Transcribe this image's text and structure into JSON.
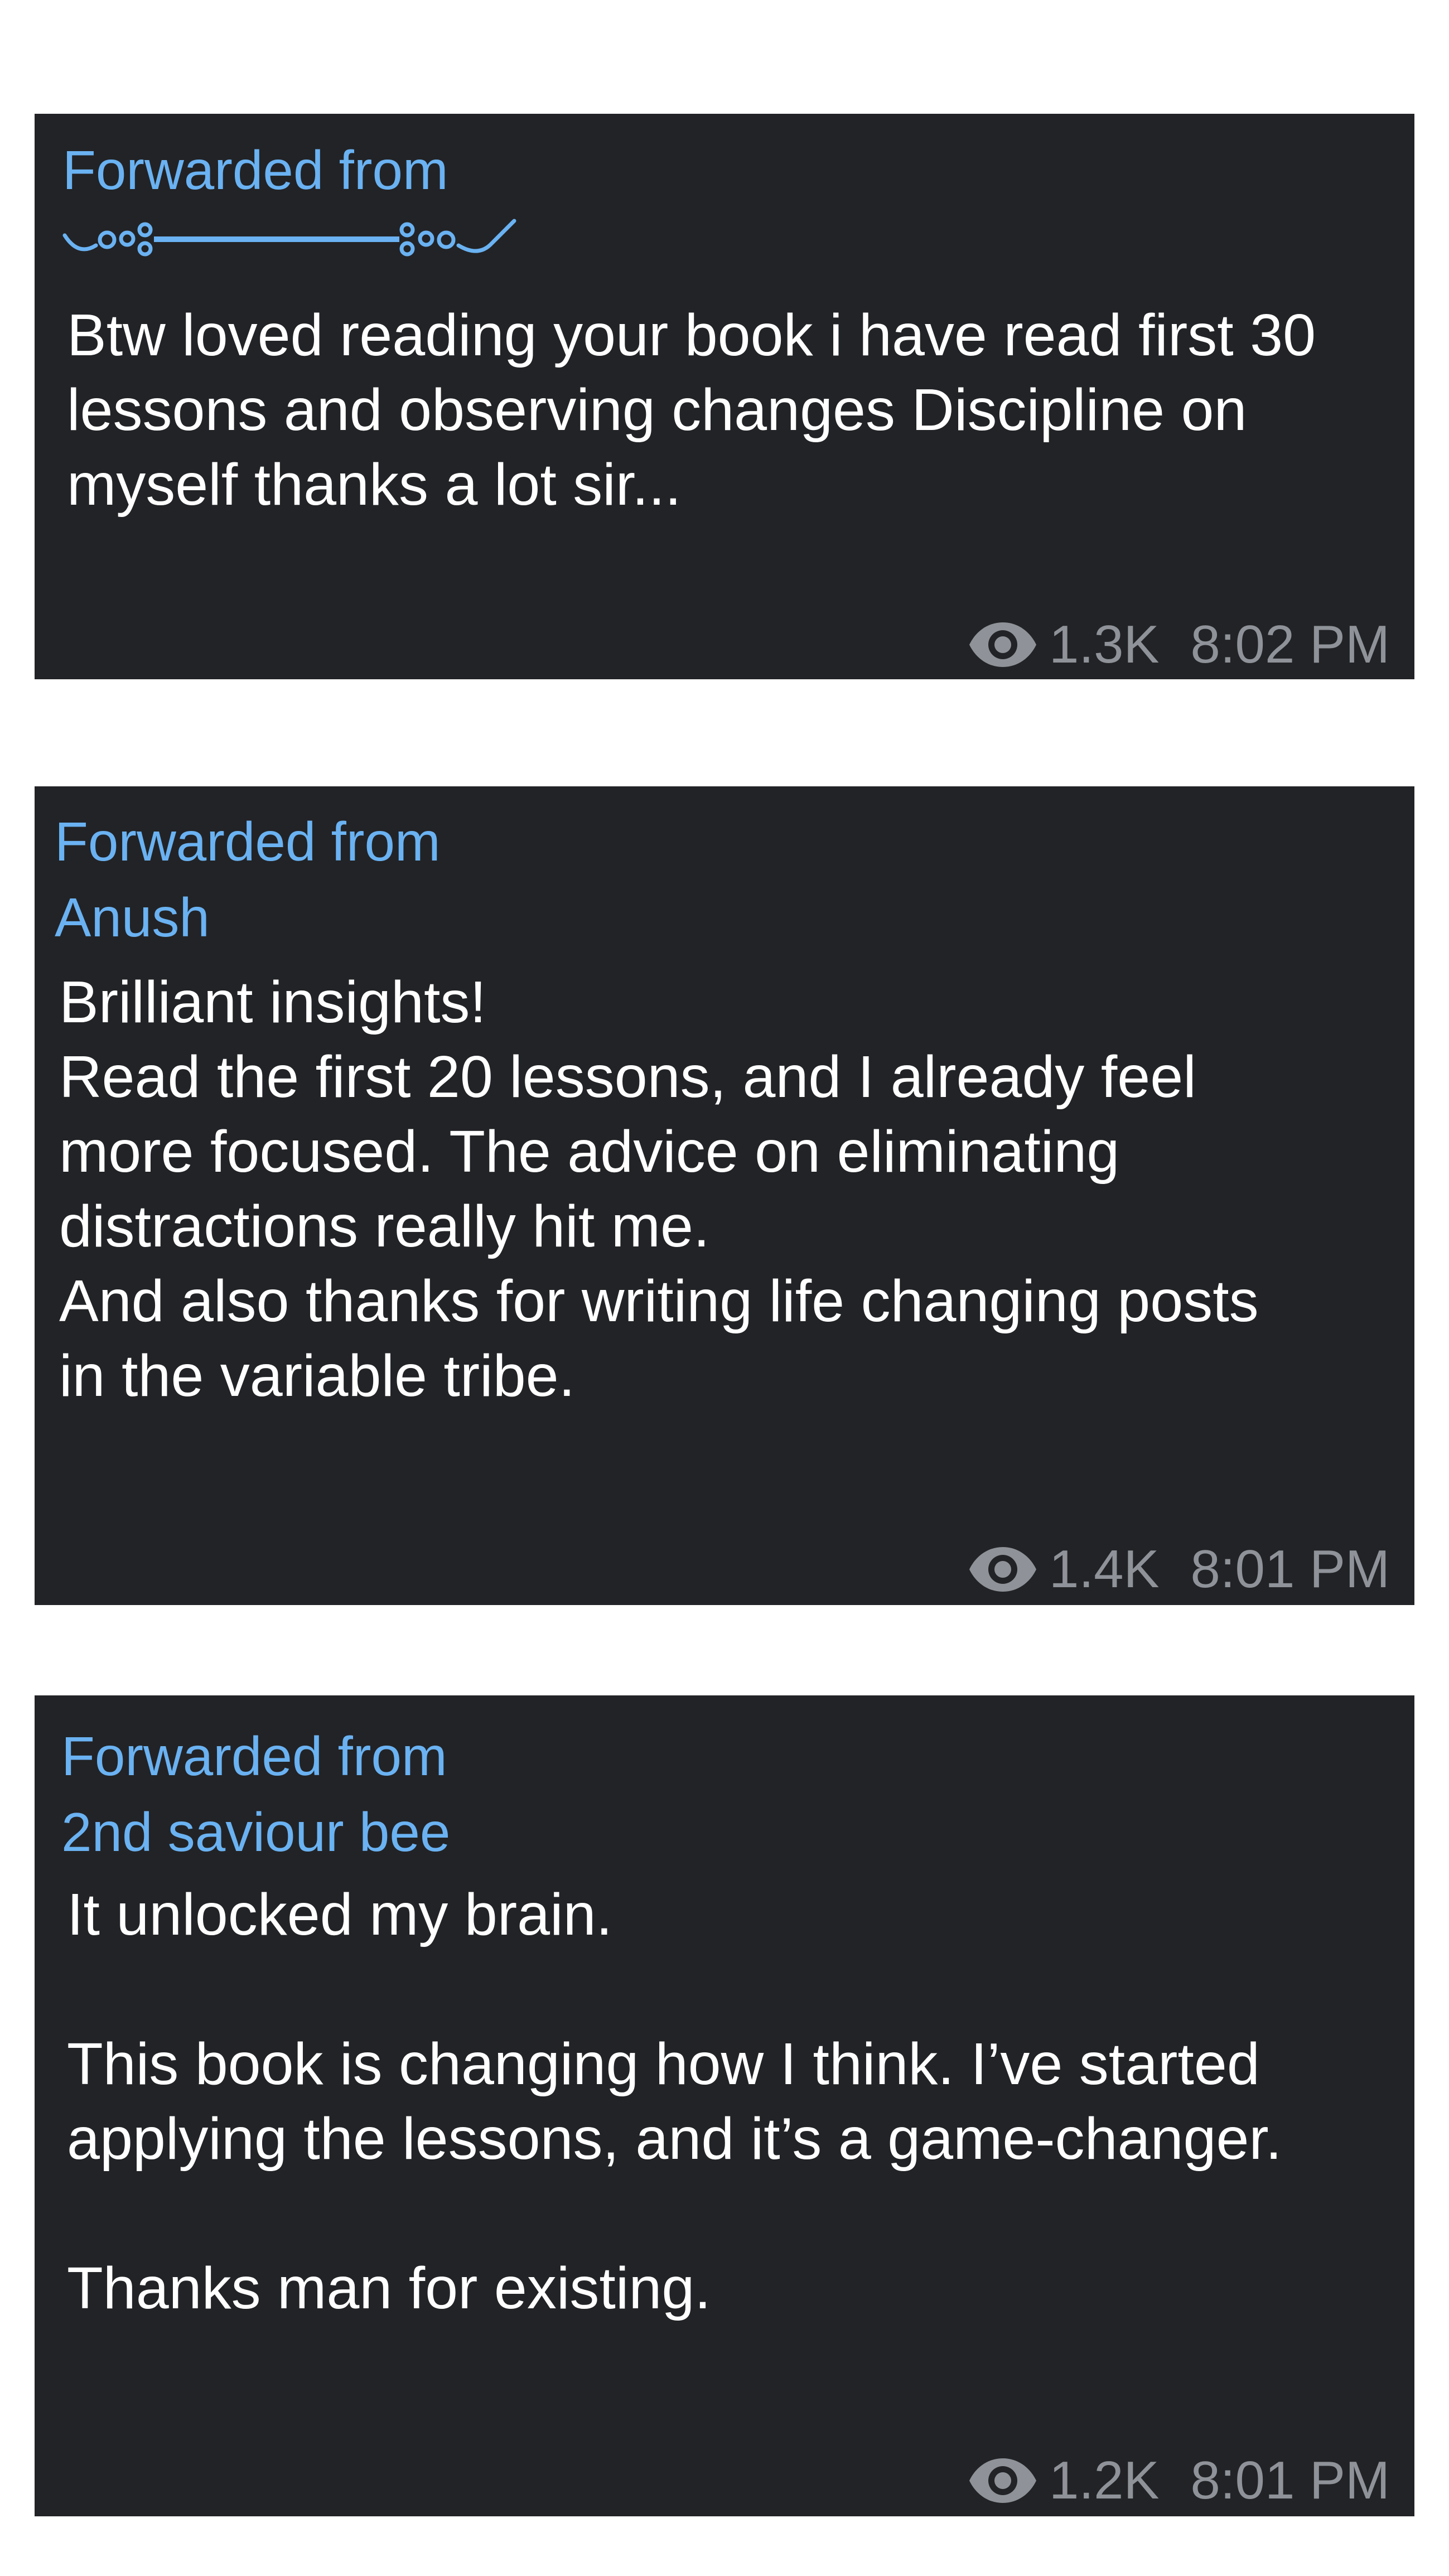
{
  "messages": [
    {
      "forwarded_label": "Forwarded from",
      "sender": "",
      "text": "Btw loved reading your book i have read first 30\nlessons and observing changes Discipline on\nmyself thanks a lot sir...",
      "views": "1.3K",
      "time": "8:02 PM"
    },
    {
      "forwarded_label": "Forwarded from",
      "sender": "Anush",
      "text": "Brilliant insights!\nRead the first 20 lessons, and I already feel\nmore focused. The advice on eliminating\ndistractions really hit me.\nAnd also thanks for writing life changing posts\nin the variable tribe.",
      "views": "1.4K",
      "time": "8:01 PM"
    },
    {
      "forwarded_label": "Forwarded from",
      "sender": "2nd saviour bee",
      "text": "It unlocked my brain.\n\nThis book is changing how I think. I’ve started\napplying the lessons, and it’s a game-changer.\n\nThanks man for existing.",
      "views": "1.2K",
      "time": "8:01 PM"
    }
  ],
  "colors": {
    "card_background": "#222326",
    "link_blue": "#6ab2f2",
    "meta_gray": "#8f9399",
    "page_background": "#ffffff"
  },
  "icons": {
    "views": "eye-icon",
    "sender_ornament": "decorative-divider-icon"
  }
}
